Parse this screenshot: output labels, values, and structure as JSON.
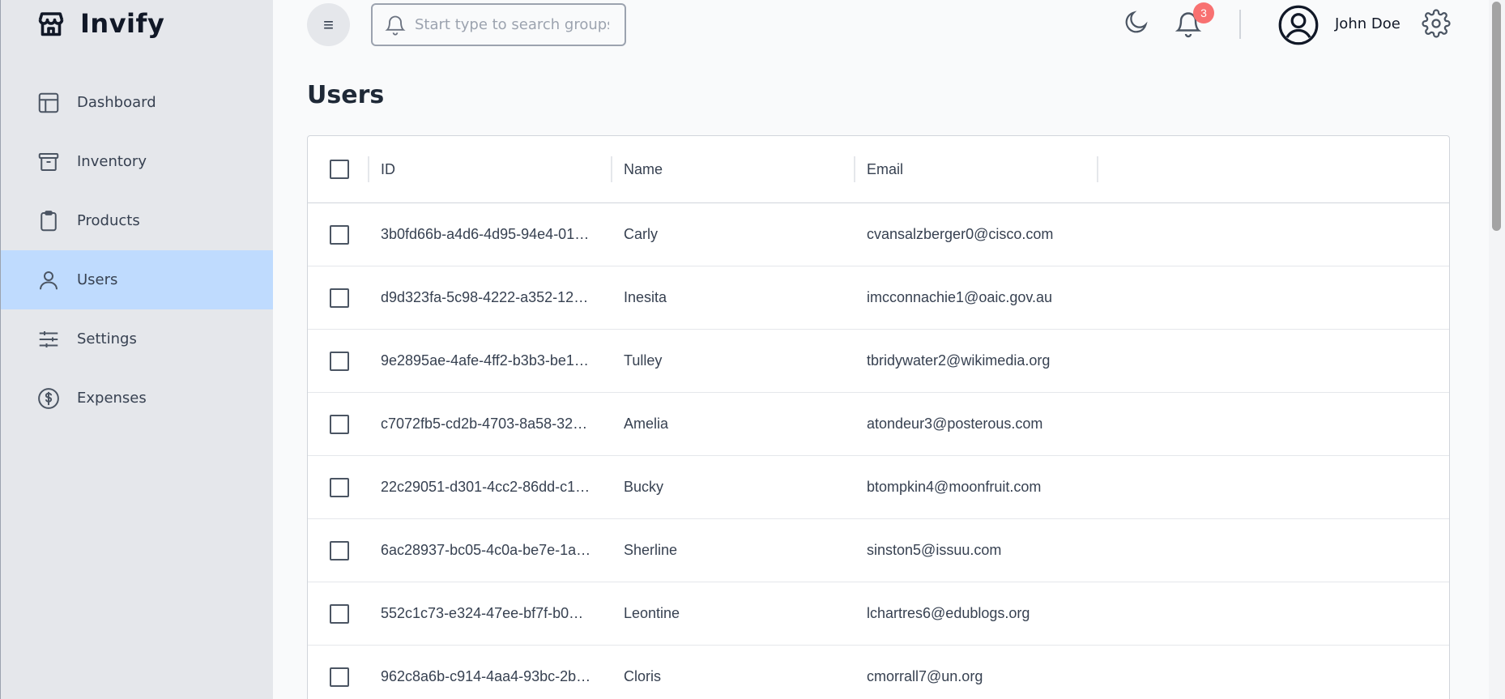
{
  "app": {
    "name": "Invify"
  },
  "sidebar": {
    "items": [
      {
        "label": "Dashboard",
        "icon": "dashboard-icon"
      },
      {
        "label": "Inventory",
        "icon": "archive-icon"
      },
      {
        "label": "Products",
        "icon": "clipboard-icon"
      },
      {
        "label": "Users",
        "icon": "user-icon",
        "active": true
      },
      {
        "label": "Settings",
        "icon": "sliders-icon"
      },
      {
        "label": "Expenses",
        "icon": "dollar-icon"
      }
    ]
  },
  "header": {
    "menu_glyph": "≡",
    "search_placeholder": "Start type to search groups",
    "notification_count": "3",
    "user_name": "John Doe"
  },
  "page": {
    "title": "Users"
  },
  "table": {
    "columns": [
      "ID",
      "Name",
      "Email"
    ],
    "rows": [
      {
        "id": "3b0fd66b-a4d6-4d95-94e4-01…",
        "name": "Carly",
        "email": "cvansalzberger0@cisco.com"
      },
      {
        "id": "d9d323fa-5c98-4222-a352-12…",
        "name": "Inesita",
        "email": "imcconnachie1@oaic.gov.au"
      },
      {
        "id": "9e2895ae-4afe-4ff2-b3b3-be1…",
        "name": "Tulley",
        "email": "tbridywater2@wikimedia.org"
      },
      {
        "id": "c7072fb5-cd2b-4703-8a58-32…",
        "name": "Amelia",
        "email": "atondeur3@posterous.com"
      },
      {
        "id": "22c29051-d301-4cc2-86dd-c1…",
        "name": "Bucky",
        "email": "btompkin4@moonfruit.com"
      },
      {
        "id": "6ac28937-bc05-4c0a-be7e-1a…",
        "name": "Sherline",
        "email": "sinston5@issuu.com"
      },
      {
        "id": "552c1c73-e324-47ee-bf7f-b0…",
        "name": "Leontine",
        "email": "lchartres6@edublogs.org"
      },
      {
        "id": "962c8a6b-c914-4aa4-93bc-2b…",
        "name": "Cloris",
        "email": "cmorrall7@un.org"
      }
    ]
  },
  "colors": {
    "active_nav": "#bfdbfe",
    "sidebar_bg": "#e5e7eb",
    "badge": "#f87171"
  }
}
